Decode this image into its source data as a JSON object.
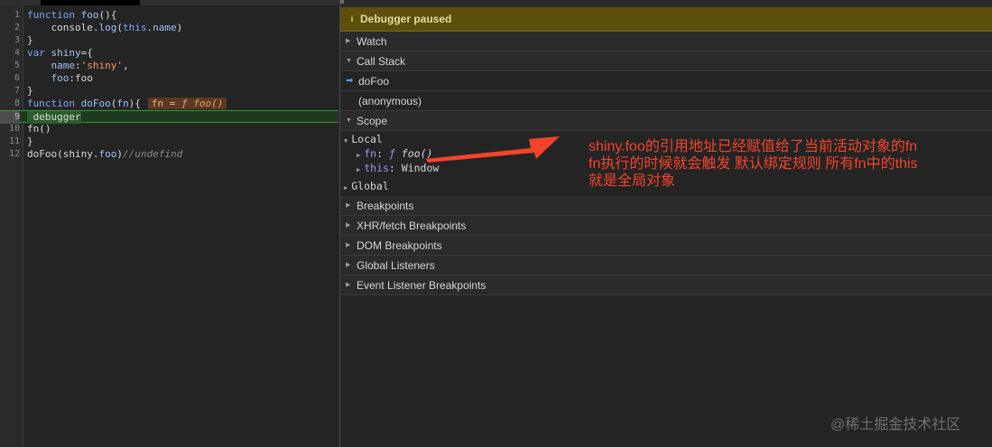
{
  "editor": {
    "lines": [
      {
        "num": "1",
        "parts": [
          [
            "kw",
            "function "
          ],
          [
            "prop",
            "foo"
          ],
          [
            "plain",
            "(){"
          ]
        ]
      },
      {
        "num": "2",
        "parts": [
          [
            "plain",
            "    console."
          ],
          [
            "prop",
            "log"
          ],
          [
            "plain",
            "("
          ],
          [
            "kw",
            "this"
          ],
          [
            "plain",
            "."
          ],
          [
            "prop",
            "name"
          ],
          [
            "plain",
            ")"
          ]
        ]
      },
      {
        "num": "3",
        "parts": [
          [
            "plain",
            "}"
          ]
        ]
      },
      {
        "num": "4",
        "parts": [
          [
            "kw",
            "var "
          ],
          [
            "prop",
            "shiny"
          ],
          [
            "plain",
            "={"
          ]
        ]
      },
      {
        "num": "5",
        "parts": [
          [
            "plain",
            "    "
          ],
          [
            "prop",
            "name"
          ],
          [
            "plain",
            ":"
          ],
          [
            "str",
            "'shiny'"
          ],
          [
            "plain",
            ","
          ]
        ]
      },
      {
        "num": "6",
        "parts": [
          [
            "plain",
            "    "
          ],
          [
            "prop",
            "foo"
          ],
          [
            "plain",
            ":foo"
          ]
        ]
      },
      {
        "num": "7",
        "parts": [
          [
            "plain",
            "}"
          ]
        ]
      },
      {
        "num": "8",
        "parts": [
          [
            "kw",
            "function "
          ],
          [
            "prop",
            "doFoo"
          ],
          [
            "plain",
            "("
          ],
          [
            "prop",
            "fn"
          ],
          [
            "plain",
            "){"
          ]
        ]
      },
      {
        "num": "9",
        "parts": [
          [
            "plain",
            " debugger"
          ]
        ]
      },
      {
        "num": "10",
        "parts": [
          [
            "plain",
            "fn()"
          ]
        ]
      },
      {
        "num": "11",
        "parts": [
          [
            "plain",
            "}"
          ]
        ]
      },
      {
        "num": "12",
        "parts": [
          [
            "plain",
            "doFoo(shiny."
          ],
          [
            "prop",
            "foo"
          ],
          [
            "plain",
            ")"
          ],
          [
            "cm",
            "//undefind"
          ]
        ]
      }
    ],
    "inline_value": {
      "name": "fn",
      "eq": " = ",
      "f": "ƒ",
      "sig": " foo()"
    }
  },
  "debugger": {
    "paused_label": "Debugger paused",
    "watch": "Watch",
    "call_stack": "Call Stack",
    "frames": [
      "doFoo",
      "(anonymous)"
    ],
    "scope": "Scope",
    "local": "Local",
    "fn_key": "fn",
    "fn_f": "ƒ",
    "fn_sig": " foo()",
    "this_key": "this",
    "this_val": "Window",
    "global": "Global",
    "sections": [
      "Breakpoints",
      "XHR/fetch Breakpoints",
      "DOM Breakpoints",
      "Global Listeners",
      "Event Listener Breakpoints"
    ]
  },
  "annotation": {
    "line1": "shiny.foo的引用地址已经赋值给了当前活动对象的fn",
    "line2": "fn执行的时候就会触发 默认绑定规则 所有fn中的this",
    "line3": "就是全局对象",
    "color": "#f5432a"
  },
  "watermark": "@稀土掘金技术社区",
  "icons": {
    "info": "info-icon",
    "current_frame": "arrow-right-icon",
    "expand": "triangle-right-icon",
    "collapse": "triangle-down-icon"
  }
}
